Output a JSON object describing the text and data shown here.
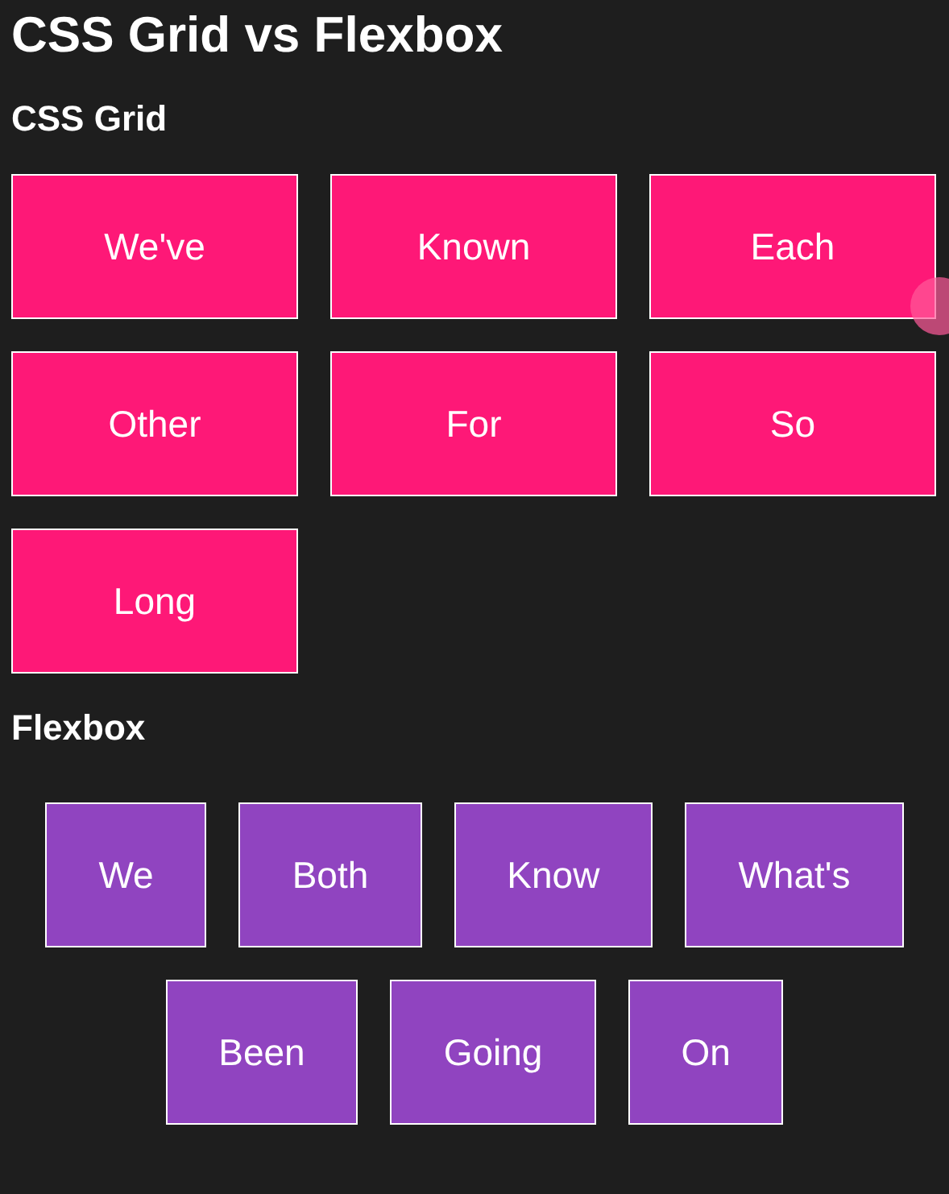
{
  "title": "CSS Grid vs Flexbox",
  "grid_section": {
    "heading": "CSS Grid",
    "items": [
      "We've",
      "Known",
      "Each",
      "Other",
      "For",
      "So",
      "Long"
    ]
  },
  "flex_section": {
    "heading": "Flexbox",
    "items": [
      "We",
      "Both",
      "Know",
      "What's",
      "Been",
      "Going",
      "On"
    ]
  }
}
